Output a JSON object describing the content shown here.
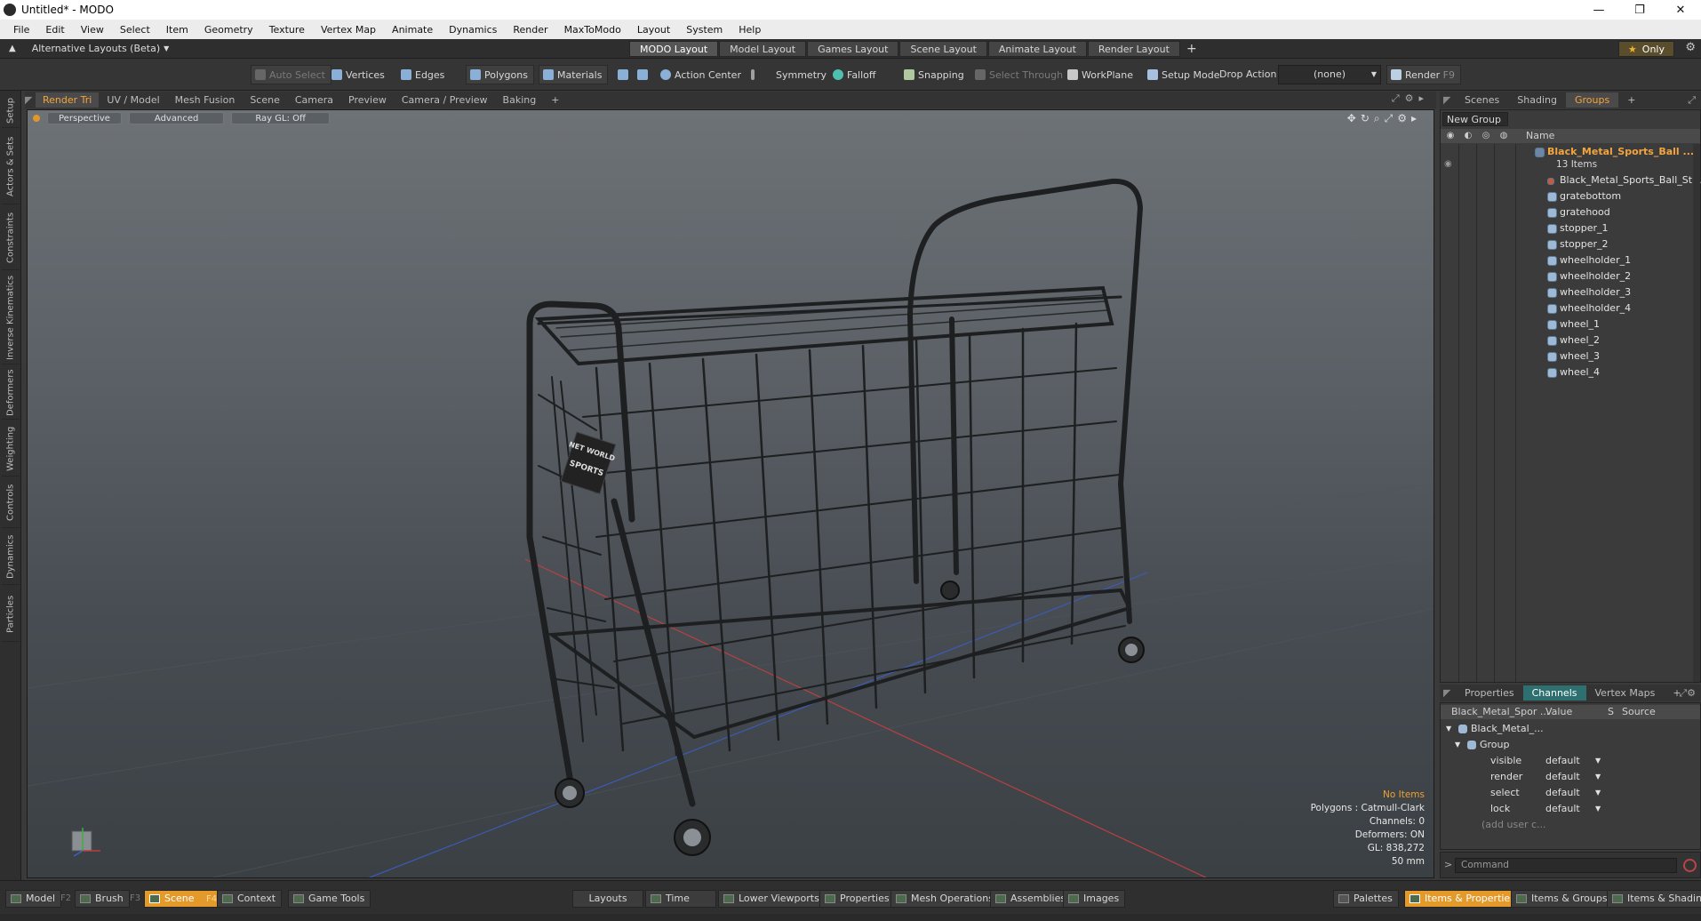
{
  "window": {
    "title": "Untitled* - MODO",
    "min": "—",
    "max": "❐",
    "close": "✕"
  },
  "menu": [
    "File",
    "Edit",
    "View",
    "Select",
    "Item",
    "Geometry",
    "Texture",
    "Vertex Map",
    "Animate",
    "Dynamics",
    "Render",
    "MaxToModo",
    "Layout",
    "System",
    "Help"
  ],
  "layoutbar": {
    "alt_layouts": "Alternative Layouts (Beta)",
    "tabs": [
      "MODO Layout",
      "Model Layout",
      "Games Layout",
      "Scene Layout",
      "Animate Layout",
      "Render Layout"
    ],
    "active_tab": "MODO Layout",
    "only": "Only"
  },
  "toolbar": {
    "auto_select": "Auto Select",
    "vertices": "Vertices",
    "edges": "Edges",
    "polygons": "Polygons",
    "materials": "Materials",
    "action_center": "Action Center",
    "symmetry": "Symmetry",
    "falloff": "Falloff",
    "snapping": "Snapping",
    "select_through": "Select Through",
    "workplane": "WorkPlane",
    "setup_mode": "Setup Mode",
    "drop_action": "Drop Action",
    "drop_value": "(none)",
    "render": "Render",
    "render_key": "F9"
  },
  "left_tabs": [
    "Setup",
    "Actors & Sets",
    "Constraints",
    "Inverse Kinematics",
    "Deformers",
    "Weighting",
    "Controls",
    "Dynamics",
    "Particles"
  ],
  "viewport_tabs": [
    "Render Tri",
    "UV / Model",
    "Mesh Fusion",
    "Scene",
    "Camera",
    "Preview",
    "Camera / Preview",
    "Baking"
  ],
  "viewport": {
    "perspective": "Perspective",
    "advanced": "Advanced",
    "raygl": "Ray GL: Off",
    "sign_text": "NET WORLD SPORTS",
    "info": {
      "no_items": "No Items",
      "polygons": "Polygons : Catmull-Clark",
      "channels": "Channels: 0",
      "deformers": "Deformers: ON",
      "gl": "GL: 838,272",
      "focal": "50 mm"
    }
  },
  "right_tabs": [
    "Scenes",
    "Shading",
    "Groups"
  ],
  "groups": {
    "new_group": "New Group",
    "name_header": "Name",
    "parent": "Black_Metal_Sports_Ball ...",
    "item_count": "13 Items",
    "children": [
      "Black_Metal_Sports_Ball_St...",
      "gratebottom",
      "gratehood",
      "stopper_1",
      "stopper_2",
      "wheelholder_1",
      "wheelholder_2",
      "wheelholder_3",
      "wheelholder_4",
      "wheel_1",
      "wheel_2",
      "wheel_3",
      "wheel_4"
    ]
  },
  "channel_tabs": [
    "Properties",
    "Channels",
    "Vertex Maps"
  ],
  "channels": {
    "headers": {
      "name": "Black_Metal_Spor ...",
      "value": "Value",
      "s": "S",
      "source": "Source"
    },
    "root": "Black_Metal_...",
    "group": "Group",
    "rows": [
      {
        "name": "visible",
        "value": "default"
      },
      {
        "name": "render",
        "value": "default"
      },
      {
        "name": "select",
        "value": "default"
      },
      {
        "name": "lock",
        "value": "default"
      }
    ],
    "add_user": "(add user c..."
  },
  "command": {
    "placeholder": "Command"
  },
  "bottombar": {
    "model": "Model",
    "model_key": "F2",
    "brush": "Brush",
    "brush_key": "F3",
    "scene": "Scene",
    "scene_key": "F4",
    "context": "Context",
    "game_tools": "Game Tools",
    "layouts": "Layouts",
    "time": "Time",
    "lower_viewports": "Lower Viewports",
    "properties": "Properties",
    "mesh_operations": "Mesh Operations",
    "assemblies": "Assemblies",
    "images": "Images",
    "palettes": "Palettes",
    "items_properties": "Items & Properties",
    "items_groups": "Items & Groups",
    "items_shading": "Items & Shading"
  }
}
